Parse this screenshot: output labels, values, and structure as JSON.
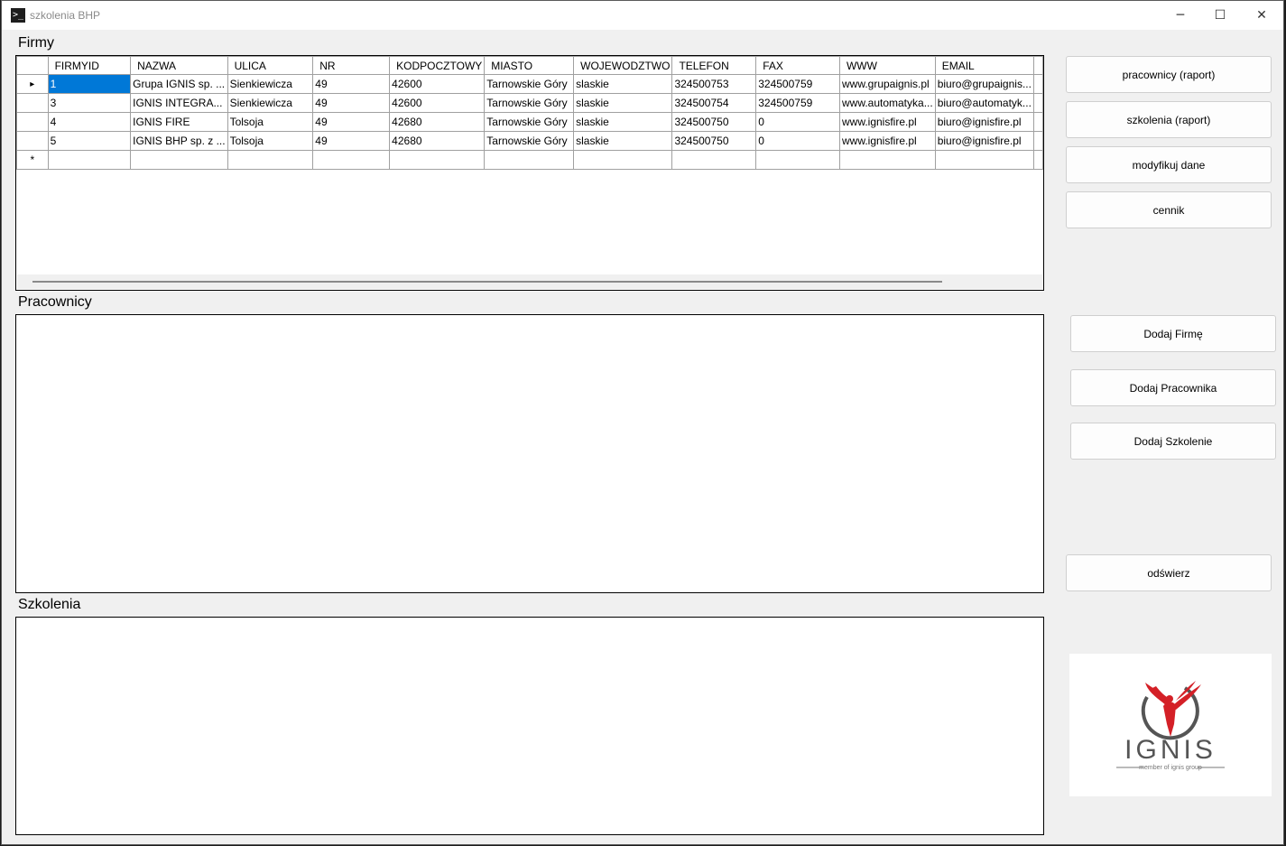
{
  "window": {
    "title": "szkolenia BHP",
    "controls": {
      "minimize": "─",
      "maximize": "☐",
      "close": "✕"
    }
  },
  "sections": {
    "firmy": "Firmy",
    "pracownicy": "Pracownicy",
    "szkolenia": "Szkolenia"
  },
  "firmy_grid": {
    "columns": [
      "FIRMYID",
      "NAZWA",
      "ULICA",
      "NR",
      "KODPOCZTOWY",
      "MIASTO",
      "WOJEWODZTWO",
      "TELEFON",
      "FAX",
      "WWW",
      "EMAIL"
    ],
    "rows": [
      [
        "1",
        "Grupa IGNIS sp. ...",
        "Sienkiewicza",
        "49",
        "42600",
        "Tarnowskie Góry",
        "slaskie",
        "324500753",
        "324500759",
        "www.grupaignis.pl",
        "biuro@grupaignis..."
      ],
      [
        "3",
        "IGNIS INTEGRA...",
        "Sienkiewicza",
        "49",
        "42600",
        "Tarnowskie Góry",
        "slaskie",
        "324500754",
        "324500759",
        "www.automatyka...",
        "biuro@automatyk..."
      ],
      [
        "4",
        "IGNIS FIRE",
        "Tolsoja",
        "49",
        "42680",
        "Tarnowskie Góry",
        "slaskie",
        "324500750",
        "0",
        "www.ignisfire.pl",
        "biuro@ignisfire.pl"
      ],
      [
        "5",
        "IGNIS BHP sp. z ...",
        "Tolsoja",
        "49",
        "42680",
        "Tarnowskie Góry",
        "slaskie",
        "324500750",
        "0",
        "www.ignisfire.pl",
        "biuro@ignisfire.pl"
      ]
    ],
    "current_row_marker": "▸",
    "new_row_marker": "*"
  },
  "buttons": {
    "pracownicy_raport": "pracownicy (raport)",
    "szkolenia_raport": "szkolenia (raport)",
    "modyfikuj_dane": "modyfikuj dane",
    "cennik": "cennik",
    "dodaj_firme": "Dodaj Firmę",
    "dodaj_pracownika": "Dodaj Pracownika",
    "dodaj_szkolenie": "Dodaj Szkolenie",
    "odswiez": "odświerz"
  },
  "logo": {
    "text": "IGNIS",
    "tagline": "member of ignis group",
    "colors": {
      "phoenix": "#d42027",
      "ring": "#555555",
      "text": "#555555"
    }
  },
  "colors": {
    "selection": "#0078d7",
    "window_bg": "#f0f0f0"
  }
}
